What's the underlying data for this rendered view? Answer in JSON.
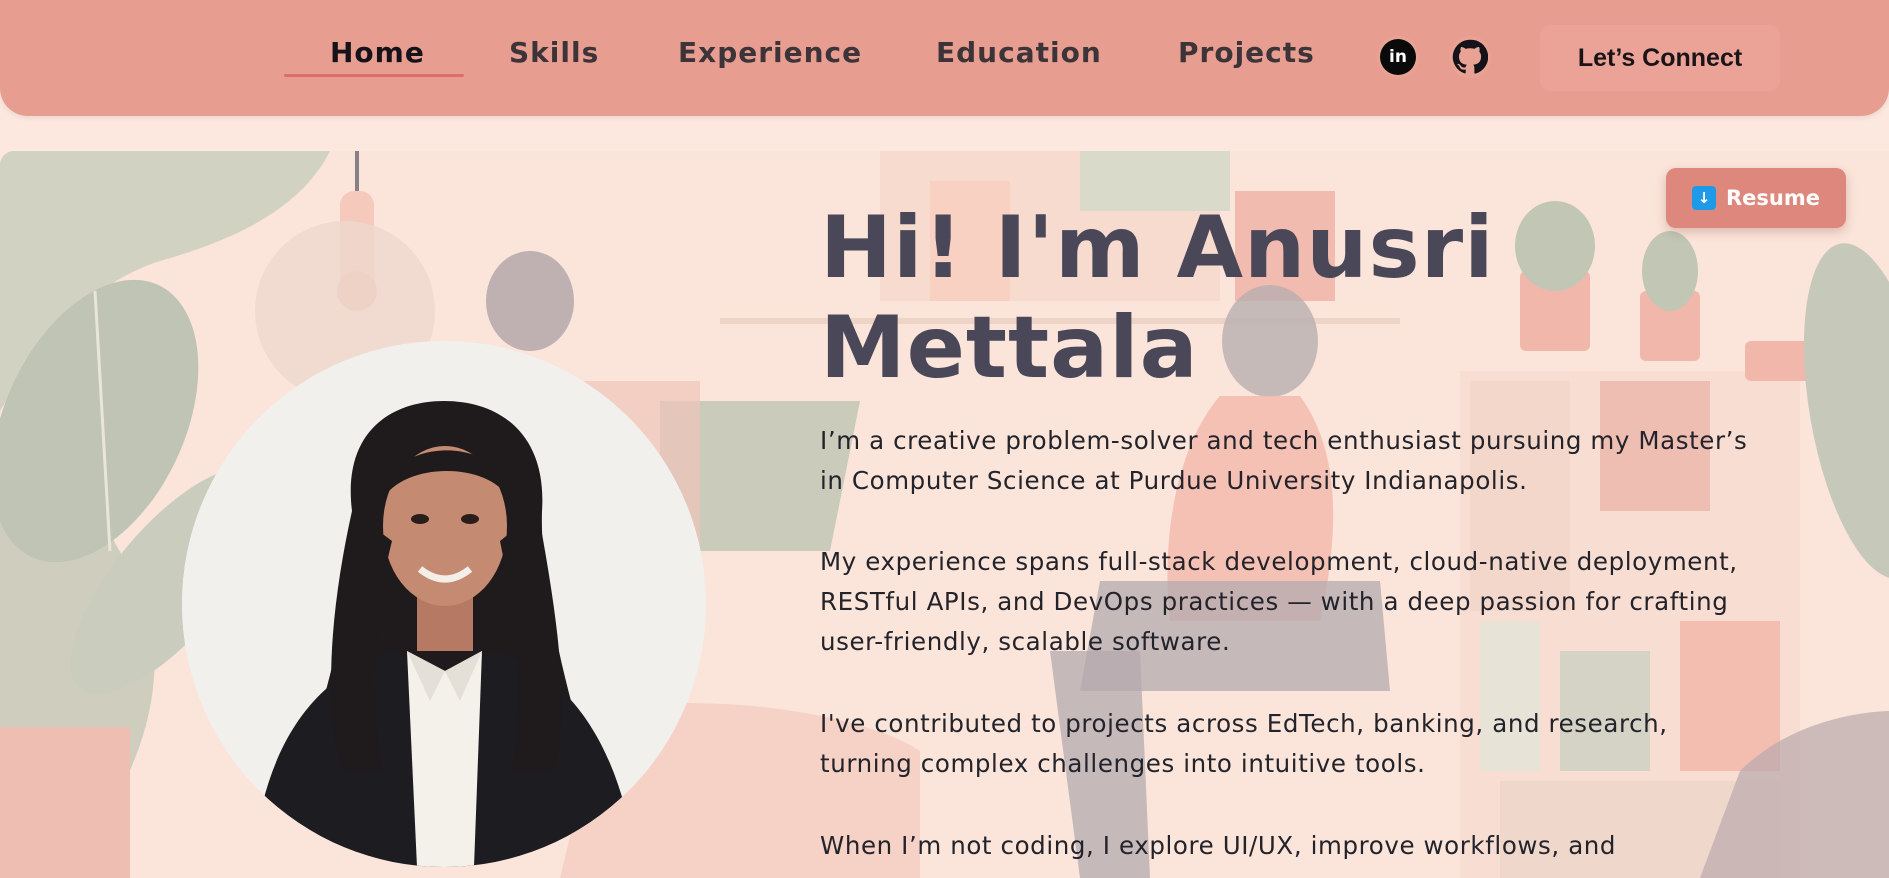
{
  "nav": {
    "links": [
      {
        "label": "Home",
        "active": true
      },
      {
        "label": "Skills",
        "active": false
      },
      {
        "label": "Experience",
        "active": false
      },
      {
        "label": "Education",
        "active": false
      },
      {
        "label": "Projects",
        "active": false
      }
    ],
    "social": [
      {
        "icon": "linkedin-icon",
        "glyph": "in"
      },
      {
        "icon": "github-icon"
      }
    ],
    "connect_label": "Let’s Connect"
  },
  "hero": {
    "resume_label": "Resume",
    "resume_icon": "download-arrow-icon",
    "title": "Hi! I'm Anusri Mettala",
    "paragraphs": [
      "I’m a creative problem-solver and tech enthusiast pursuing my Master’s in Computer Science at Purdue University Indianapolis.",
      "My experience spans full-stack development, cloud-native deployment, RESTful APIs, and DevOps practices — with a deep passion for crafting user-friendly, scalable software.",
      "I've contributed to projects across EdTech, banking, and research, turning complex challenges into intuitive tools.",
      "When I’m not coding, I explore UI/UX, improve workflows, and"
    ]
  },
  "colors": {
    "navbar": "#e89d91",
    "accent": "#dd877d",
    "title": "#4a4858",
    "background": "#fbe3d8"
  }
}
